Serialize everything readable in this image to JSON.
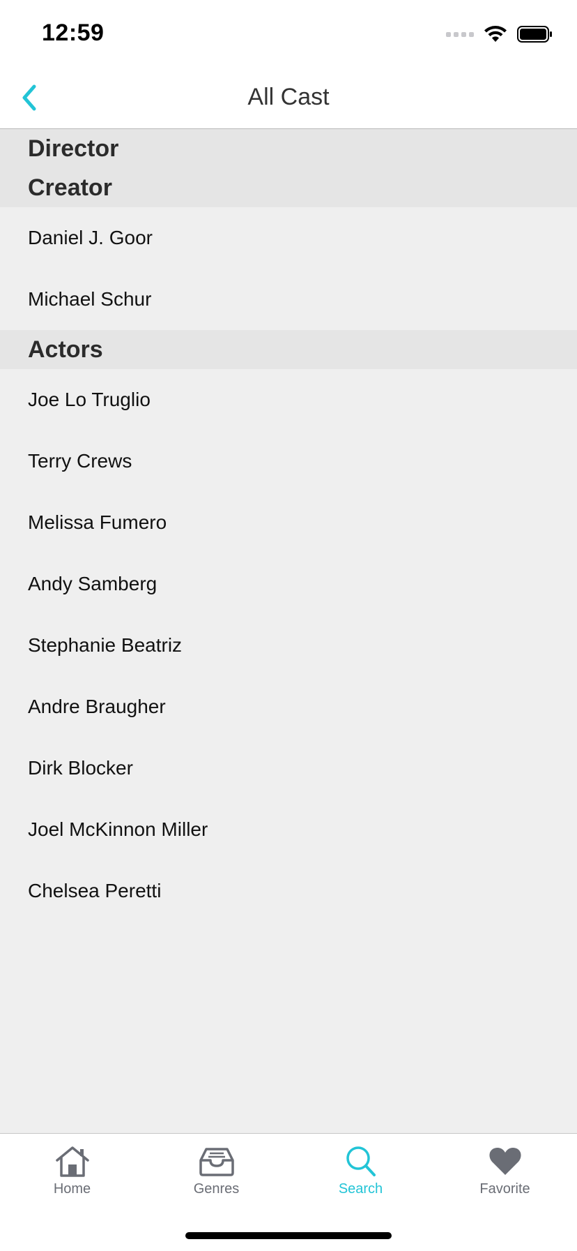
{
  "status": {
    "time": "12:59"
  },
  "nav": {
    "title": "All Cast",
    "back_icon": "chevron-left-icon"
  },
  "sections": [
    {
      "headers": [
        "Director",
        "Creator"
      ],
      "rows": [
        "Daniel J. Goor",
        "Michael Schur"
      ]
    },
    {
      "headers": [
        "Actors"
      ],
      "rows": [
        "Joe Lo Truglio",
        "Terry Crews",
        "Melissa Fumero",
        "Andy Samberg",
        "Stephanie Beatriz",
        "Andre Braugher",
        "Dirk Blocker",
        "Joel McKinnon Miller",
        "Chelsea Peretti"
      ]
    }
  ],
  "tabs": [
    {
      "label": "Home",
      "icon": "home-icon",
      "active": false
    },
    {
      "label": "Genres",
      "icon": "inbox-icon",
      "active": false
    },
    {
      "label": "Search",
      "icon": "search-icon",
      "active": true
    },
    {
      "label": "Favorite",
      "icon": "heart-icon",
      "active": false
    }
  ],
  "colors": {
    "accent": "#22c4d6",
    "inactive": "#6a6d75",
    "section_bg": "#e5e5e5",
    "list_bg": "#efefef"
  }
}
